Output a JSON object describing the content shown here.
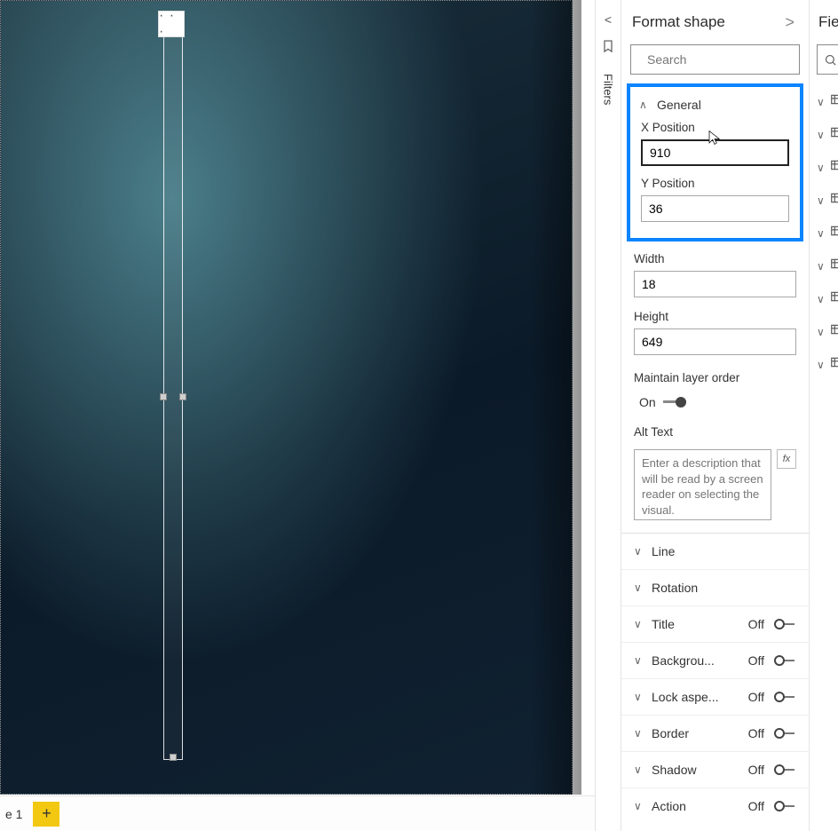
{
  "canvas": {
    "context_menu_label": "· · ·",
    "page_tab": "e 1",
    "add_page": "+"
  },
  "filters": {
    "collapse_chevron": "<",
    "label": "Filters"
  },
  "format": {
    "title": "Format shape",
    "nav_next": ">",
    "search_placeholder": "Search",
    "sections": {
      "general": {
        "label": "General",
        "x_label": "X Position",
        "x_value": "910",
        "y_label": "Y Position",
        "y_value": "36",
        "width_label": "Width",
        "width_value": "18",
        "height_label": "Height",
        "height_value": "649",
        "maintain_label": "Maintain layer order",
        "maintain_state": "On",
        "alt_label": "Alt Text",
        "alt_placeholder": "Enter a description that will be read by a screen reader on selecting the visual.",
        "fx": "fx"
      },
      "line": {
        "label": "Line"
      },
      "rotation": {
        "label": "Rotation"
      },
      "title": {
        "label": "Title",
        "state": "Off"
      },
      "background": {
        "label": "Backgrou...",
        "state": "Off"
      },
      "lockaspect": {
        "label": "Lock aspe...",
        "state": "Off"
      },
      "border": {
        "label": "Border",
        "state": "Off"
      },
      "shadow": {
        "label": "Shadow",
        "state": "Off"
      },
      "action": {
        "label": "Action",
        "state": "Off"
      }
    }
  },
  "fields": {
    "title": "Fie",
    "items_count": 9
  }
}
